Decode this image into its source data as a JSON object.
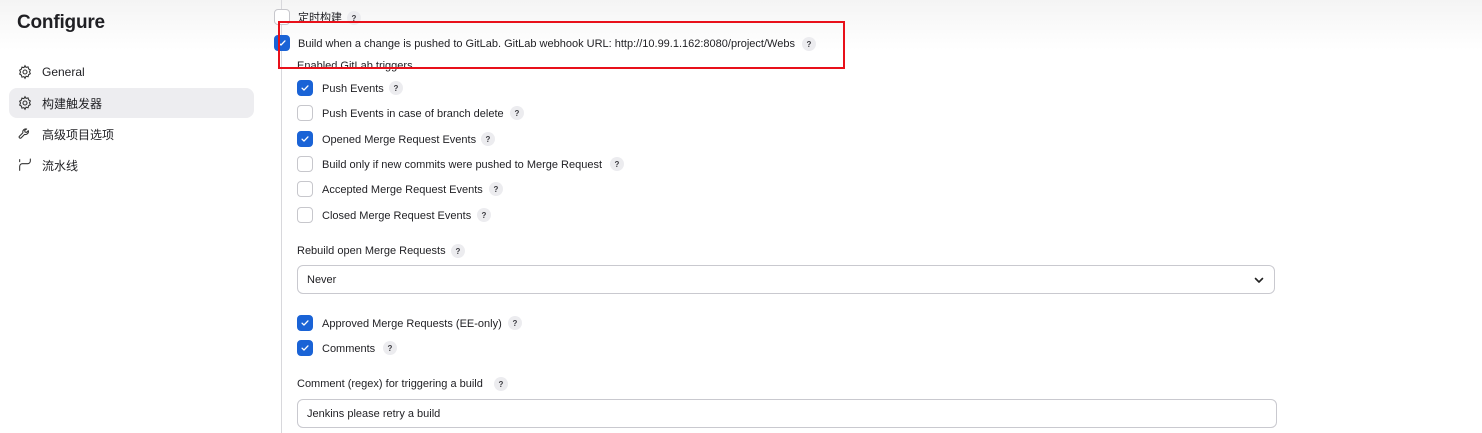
{
  "sidebar": {
    "title": "Configure",
    "items": [
      {
        "label": "General",
        "icon": "gear-icon",
        "active": false
      },
      {
        "label": "构建触发器",
        "icon": "gear-icon",
        "active": true
      },
      {
        "label": "高级项目选项",
        "icon": "wrench-icon",
        "active": false
      },
      {
        "label": "流水线",
        "icon": "pipeline-icon",
        "active": false
      }
    ]
  },
  "triggers": {
    "scheduled_build": {
      "label": "定时构建",
      "checked": false
    },
    "gitlab_push": {
      "label": "Build when a change is pushed to GitLab. GitLab webhook URL: http://10.99.1.162:8080/project/Webs",
      "checked": true
    },
    "enabled_triggers_heading": "Enabled GitLab triggers",
    "events": [
      {
        "label": "Push Events",
        "checked": true
      },
      {
        "label": "Push Events in case of branch delete",
        "checked": false
      },
      {
        "label": "Opened Merge Request Events",
        "checked": true
      },
      {
        "label": "Build only if new commits were pushed to Merge Request",
        "checked": false
      },
      {
        "label": "Accepted Merge Request Events",
        "checked": false
      },
      {
        "label": "Closed Merge Request Events",
        "checked": false
      }
    ],
    "rebuild": {
      "label": "Rebuild open Merge Requests",
      "value": "Never"
    },
    "approved": {
      "label": "Approved Merge Requests (EE-only)",
      "checked": true
    },
    "comments": {
      "label": "Comments",
      "checked": true
    },
    "comment_regex": {
      "label": "Comment (regex) for triggering a build",
      "value": "Jenkins please retry a build"
    }
  },
  "help_glyph": "?",
  "colors": {
    "accent": "#1a63d6",
    "highlight": "#e8101a",
    "active_nav": "#ededf0"
  }
}
